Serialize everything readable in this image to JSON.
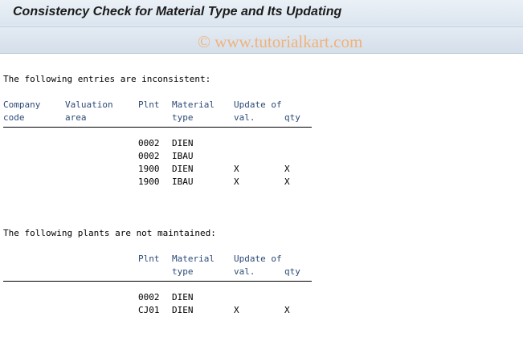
{
  "window": {
    "title": "Consistency Check for Material Type and Its Updating"
  },
  "watermark": "© www.tutorialkart.com",
  "section1": {
    "heading": "The following entries are inconsistent:",
    "headers": {
      "company_1": "Company",
      "company_2": "code",
      "valuation_1": "Valuation",
      "valuation_2": "area",
      "plant": "Plnt",
      "material_1": "Material",
      "material_2": "type",
      "update_1": "Update of",
      "update_val": "val.",
      "update_qty": "qty"
    },
    "rows": [
      {
        "plant": "0002",
        "material_type": "DIEN",
        "val": "",
        "qty": ""
      },
      {
        "plant": "0002",
        "material_type": "IBAU",
        "val": "",
        "qty": ""
      },
      {
        "plant": "1900",
        "material_type": "DIEN",
        "val": "X",
        "qty": "X"
      },
      {
        "plant": "1900",
        "material_type": "IBAU",
        "val": "X",
        "qty": "X"
      }
    ]
  },
  "section2": {
    "heading": "The following plants are not maintained:",
    "headers": {
      "plant": "Plnt",
      "material_1": "Material",
      "material_2": "type",
      "update_1": "Update of",
      "update_val": "val.",
      "update_qty": "qty"
    },
    "rows": [
      {
        "plant": "0002",
        "material_type": "DIEN",
        "val": "",
        "qty": ""
      },
      {
        "plant": "CJ01",
        "material_type": "DIEN",
        "val": "X",
        "qty": "X"
      }
    ]
  }
}
